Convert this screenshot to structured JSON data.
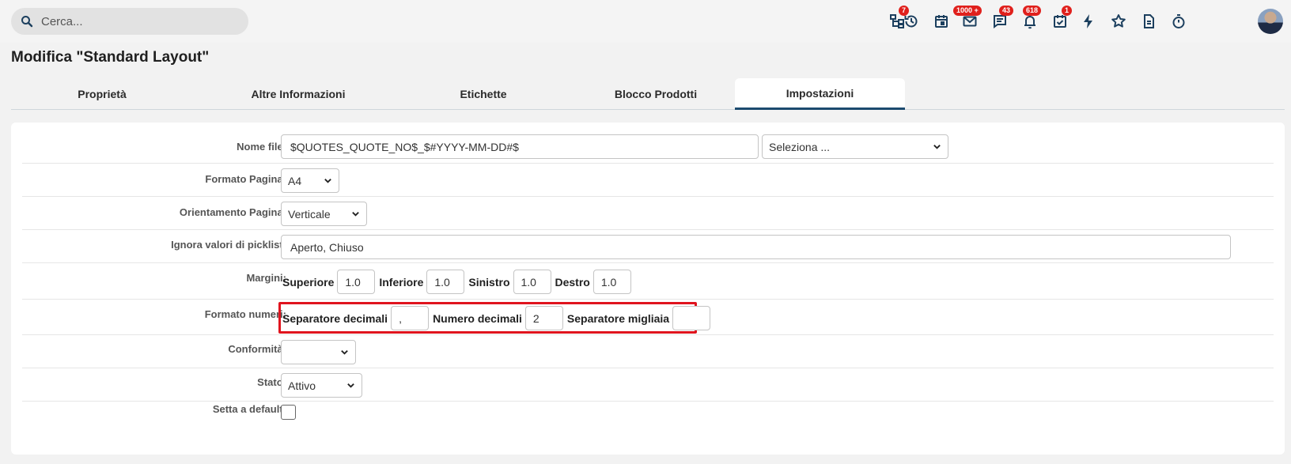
{
  "search": {
    "placeholder": "Cerca..."
  },
  "header_icons": [
    {
      "name": "hierarchy-icon",
      "badge": "7"
    },
    {
      "name": "history-icon",
      "badge": ""
    },
    {
      "name": "calendar-icon",
      "badge": ""
    },
    {
      "name": "mail-icon",
      "badge": "1000 +"
    },
    {
      "name": "chat-icon",
      "badge": "43"
    },
    {
      "name": "bell-icon",
      "badge": "618"
    },
    {
      "name": "task-check-icon",
      "badge": "1"
    },
    {
      "name": "lightning-icon",
      "badge": ""
    },
    {
      "name": "star-icon",
      "badge": ""
    },
    {
      "name": "document-icon",
      "badge": ""
    },
    {
      "name": "stopwatch-icon",
      "badge": ""
    }
  ],
  "page": {
    "title": "Modifica \"Standard Layout\""
  },
  "tabs": [
    {
      "label": "Proprietà",
      "active": false
    },
    {
      "label": "Altre Informazioni",
      "active": false
    },
    {
      "label": "Etichette",
      "active": false
    },
    {
      "label": "Blocco Prodotti",
      "active": false
    },
    {
      "label": "Impostazioni",
      "active": true
    }
  ],
  "form": {
    "filename": {
      "label": "Nome file:",
      "value": "$QUOTES_QUOTE_NO$_$#YYYY-MM-DD#$",
      "select": "Seleziona ..."
    },
    "page_format": {
      "label": "Formato Pagina:",
      "value": "A4"
    },
    "orientation": {
      "label": "Orientamento Pagina:",
      "value": "Verticale"
    },
    "ignore_picklist": {
      "label": "Ignora valori di picklist:",
      "value": "Aperto, Chiuso"
    },
    "margins": {
      "label": "Margini:",
      "top_label": "Superiore",
      "top": "1.0",
      "bottom_label": "Inferiore",
      "bottom": "1.0",
      "left_label": "Sinistro",
      "left": "1.0",
      "right_label": "Destro",
      "right": "1.0"
    },
    "number_format": {
      "label": "Formato numeri:",
      "decimal_sep_label": "Separatore decimali",
      "decimal_sep": ",",
      "decimals_label": "Numero decimali",
      "decimals": "2",
      "thousands_sep_label": "Separatore migliaia",
      "thousands_sep": ""
    },
    "conformity": {
      "label": "Conformità:",
      "value": ""
    },
    "status": {
      "label": "Stato:",
      "value": "Attivo"
    },
    "default": {
      "label": "Setta a default:",
      "checked": false
    }
  },
  "colors": {
    "accent": "#1c4a6e",
    "badge": "#e0201c",
    "highlight": "#e0141e"
  }
}
